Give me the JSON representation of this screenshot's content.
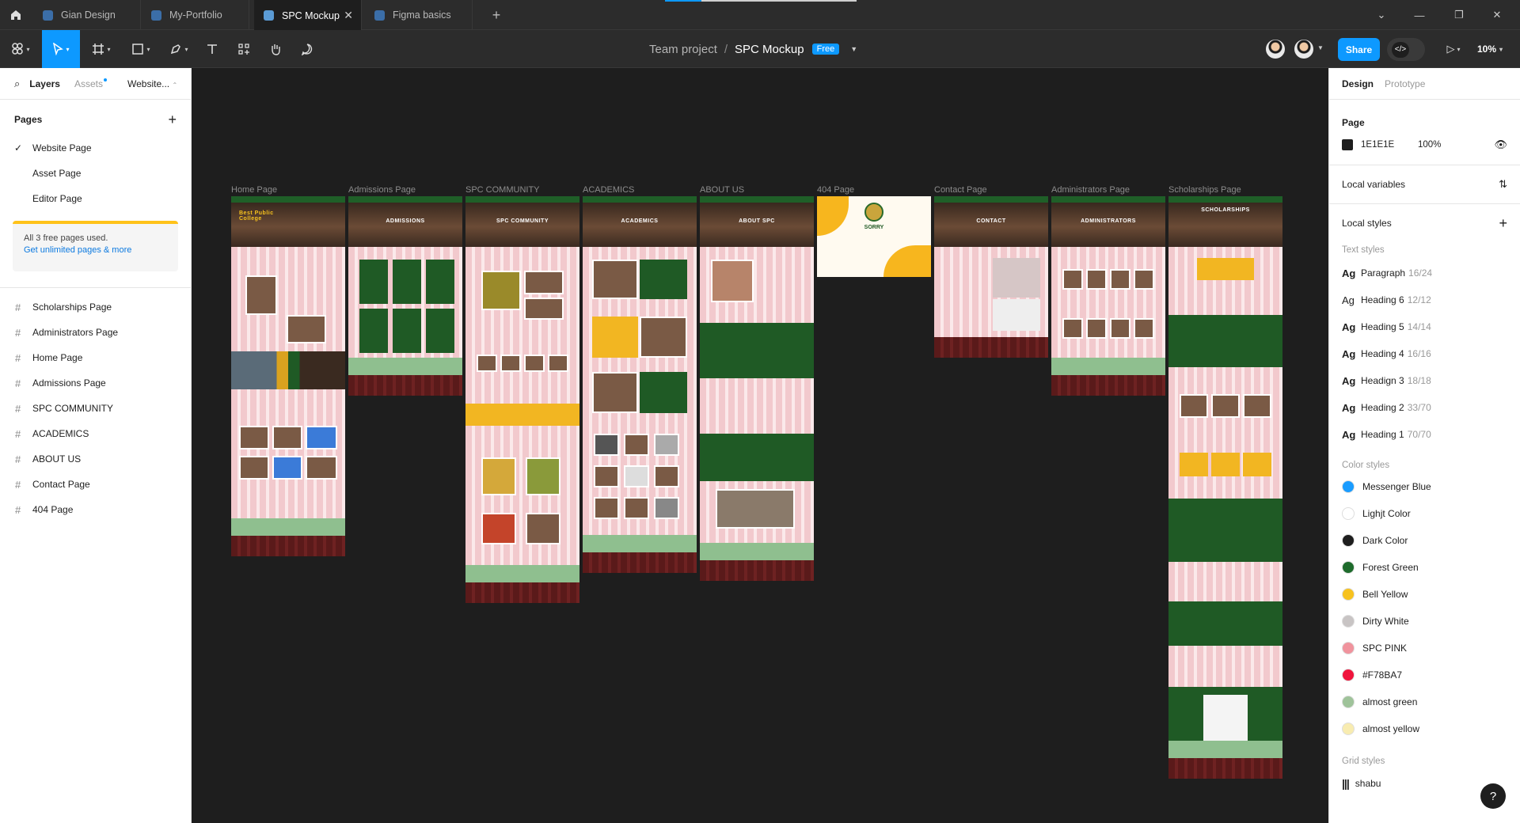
{
  "tabs": [
    {
      "label": "Gian Design",
      "active": false
    },
    {
      "label": "My-Portfolio",
      "active": false
    },
    {
      "label": "SPC Mockup",
      "active": true
    },
    {
      "label": "Figma basics",
      "active": false
    }
  ],
  "toolbar": {
    "project": "Team project",
    "separator": "/",
    "file": "SPC Mockup",
    "badge": "Free",
    "share": "Share",
    "zoom": "10%"
  },
  "left_panel": {
    "tabs": [
      "Layers",
      "Assets",
      "Website..."
    ],
    "pages_heading": "Pages",
    "pages": [
      {
        "label": "Website Page",
        "checked": true
      },
      {
        "label": "Asset Page",
        "checked": false
      },
      {
        "label": "Editor Page",
        "checked": false
      }
    ],
    "upsell_text": "All 3 free pages used.",
    "upsell_link": "Get unlimited pages & more",
    "layers": [
      "Scholarships Page",
      "Administrators Page",
      "Home Page",
      "Admissions Page",
      "SPC COMMUNITY",
      "ACADEMICS",
      "ABOUT US",
      "Contact Page",
      "404 Page"
    ]
  },
  "right_panel": {
    "tabs": [
      "Design",
      "Prototype"
    ],
    "page_heading": "Page",
    "page_color": "1E1E1E",
    "page_opacity": "100%",
    "local_variables": "Local variables",
    "local_styles": "Local styles",
    "text_styles_heading": "Text styles",
    "text_styles": [
      {
        "ag": "Ag",
        "name": "Paragraph",
        "size": "16/24"
      },
      {
        "ag": "Ag",
        "name": "Heading 6",
        "size": "12/12"
      },
      {
        "ag": "Ag",
        "name": "Heading 5",
        "size": "14/14"
      },
      {
        "ag": "Ag",
        "name": "Heading 4",
        "size": "16/16"
      },
      {
        "ag": "Ag",
        "name": "Headign 3",
        "size": "18/18"
      },
      {
        "ag": "Ag",
        "name": "Heading 2",
        "size": "33/70"
      },
      {
        "ag": "Ag",
        "name": "Heading 1",
        "size": "70/70"
      }
    ],
    "color_styles_heading": "Color styles",
    "color_styles": [
      {
        "name": "Messenger Blue",
        "color": "#1a9cff"
      },
      {
        "name": "Lighjt Color",
        "color": "#ffffff"
      },
      {
        "name": "Dark Color",
        "color": "#1e1e1e"
      },
      {
        "name": "Forest Green",
        "color": "#1e6b2c"
      },
      {
        "name": "Bell Yellow",
        "color": "#f7c21e"
      },
      {
        "name": "Dirty White",
        "color": "#c8c4c4"
      },
      {
        "name": "SPC PINK",
        "color": "#f0939d"
      },
      {
        "name": "#F78BA7",
        "color": "#f0143c"
      },
      {
        "name": "almost green",
        "color": "#9fc39a"
      },
      {
        "name": "almost yellow",
        "color": "#f8ecb0"
      }
    ],
    "grid_styles_heading": "Grid styles",
    "grid_style": "shabu"
  },
  "frames": [
    {
      "label": "Home Page",
      "hero": "Best Public College"
    },
    {
      "label": "Admissions Page",
      "hero": "ADMISSIONS"
    },
    {
      "label": "SPC COMMUNITY",
      "hero": "SPC COMMUNITY"
    },
    {
      "label": "ACADEMICS",
      "hero": "ACADEMICS"
    },
    {
      "label": "ABOUT US",
      "hero": "ABOUT SPC"
    },
    {
      "label": "404 Page",
      "hero": "SORRY"
    },
    {
      "label": "Contact Page",
      "hero": "CONTACT"
    },
    {
      "label": "Administrators Page",
      "hero": "ADMINISTRATORS"
    },
    {
      "label": "Scholarships Page",
      "hero": "SCHOLARSHIPS"
    }
  ],
  "help": "?"
}
